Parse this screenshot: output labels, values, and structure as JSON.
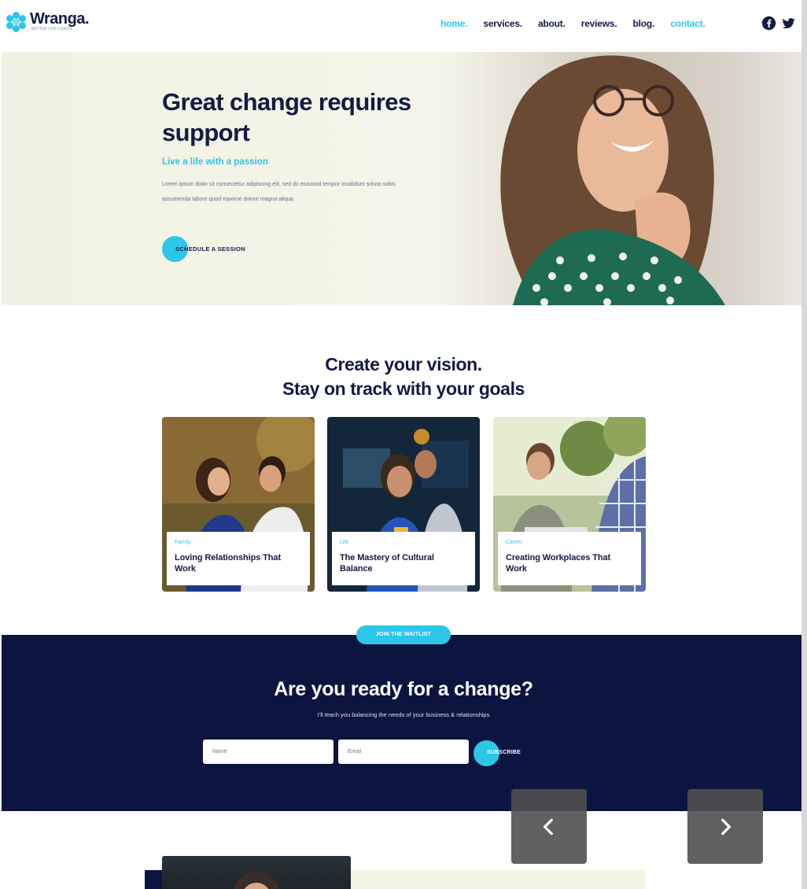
{
  "header": {
    "logo_name": "Wranga.",
    "logo_tagline": "BETTER LIFE COACH",
    "nav": [
      {
        "label": "home.",
        "active": true
      },
      {
        "label": "services.",
        "active": false
      },
      {
        "label": "about.",
        "active": false
      },
      {
        "label": "reviews.",
        "active": false
      },
      {
        "label": "blog.",
        "active": false
      },
      {
        "label": "contact.",
        "active": true
      }
    ],
    "social": [
      "facebook-icon",
      "twitter-icon"
    ]
  },
  "hero": {
    "title": "Great change requires support",
    "subtitle": "Live a life with a passion",
    "body": "Lorem ipsum dolor sit consectetur adipiscing elit, sed do eiusmod tempor incididunt soluta nobis assumenda labore quod maxime dolore magna aliqua.",
    "cta_label": "SCHEDULE A SESSION"
  },
  "vision": {
    "title_line1": "Create your vision.",
    "title_line2": "Stay on track with your goals",
    "cards": [
      {
        "category": "Family",
        "title": "Loving Relationships That Work"
      },
      {
        "category": "Life",
        "title": "The Mastery of Cultural Balance"
      },
      {
        "category": "Career",
        "title": "Creating Workplaces That Work"
      }
    ]
  },
  "cta_band": {
    "pill_label": "JOIN THE WAITLIST",
    "title": "Are you ready for a change?",
    "subtitle": "I'll teach you balancing the needs of your business & relationships",
    "name_placeholder": "Name",
    "email_placeholder": "Email",
    "subscribe_label": "SUBSCRIBE"
  },
  "carousel": {
    "prev_icon": "chevron-left-icon",
    "next_icon": "chevron-right-icon"
  },
  "colors": {
    "accent": "#2cc6e8",
    "navy": "#0c1440",
    "text": "#141a44",
    "hero_bg": "#f2f2e4"
  }
}
